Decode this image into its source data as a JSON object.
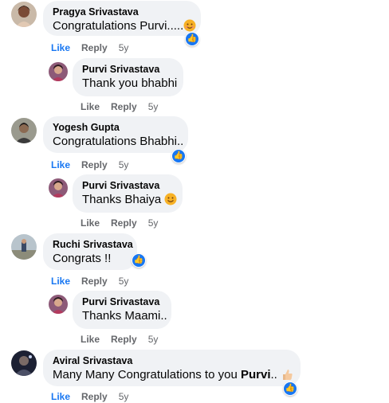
{
  "comments": [
    {
      "author": "Pragya Srivastava",
      "text": "Congratulations Purvi.....",
      "like": "Like",
      "reply": "Reply",
      "age": "5y",
      "reaction": "like-icon"
    },
    {
      "author": "Purvi Srivastava",
      "text": "Thank you bhabhi",
      "like": "Like",
      "reply": "Reply",
      "age": "5y"
    },
    {
      "author": "Yogesh Gupta",
      "text": "Congratulations Bhabhi..",
      "like": "Like",
      "reply": "Reply",
      "age": "5y",
      "reaction": "like-icon"
    },
    {
      "author": "Purvi Srivastava",
      "text": "Thanks Bhaiya",
      "like": "Like",
      "reply": "Reply",
      "age": "5y"
    },
    {
      "author": "Ruchi Srivastava",
      "text": "Congrats !!",
      "like": "Like",
      "reply": "Reply",
      "age": "5y",
      "reaction": "like-icon"
    },
    {
      "author": "Purvi Srivastava",
      "text": "Thanks Maami..",
      "like": "Like",
      "reply": "Reply",
      "age": "5y"
    },
    {
      "author": "Aviral Srivastava",
      "text_prefix": "Many Many Congratulations to you ",
      "text_bold": "Purvi",
      "text_suffix": "..",
      "like": "Like",
      "reply": "Reply",
      "age": "5y",
      "reaction": "like-icon"
    }
  ],
  "colors": {
    "link": "#1877f2",
    "muted": "#65676b",
    "bubble": "#f0f2f5"
  }
}
